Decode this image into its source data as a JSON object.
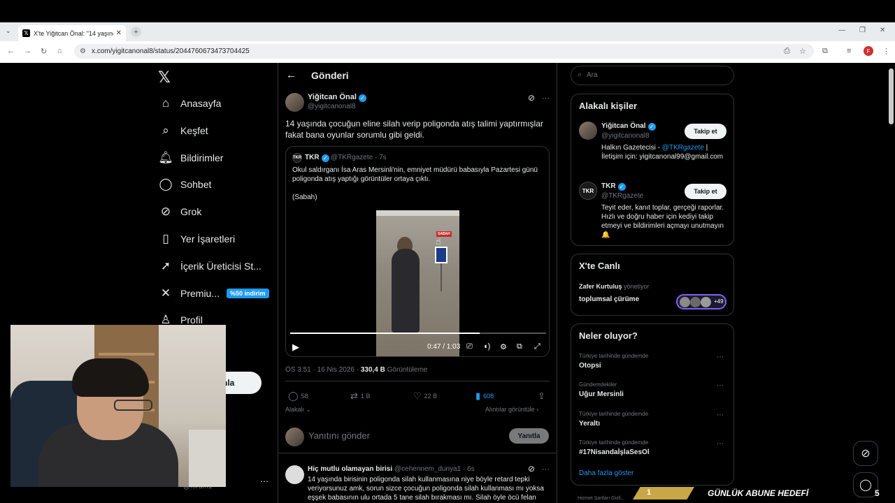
{
  "browser": {
    "tab_title": "X'te Yiğitcan Önal: \"14 yaşında",
    "url": "x.com/yigitcanonal8/status/2044760673473704425"
  },
  "nav": {
    "items": [
      {
        "label": "Anasayfa",
        "icon": "home-icon"
      },
      {
        "label": "Keşfet",
        "icon": "search-icon"
      },
      {
        "label": "Bildirimler",
        "icon": "bell-icon"
      },
      {
        "label": "Sohbet",
        "icon": "chat-icon"
      },
      {
        "label": "Grok",
        "icon": "grok-icon"
      },
      {
        "label": "Yer İşaretleri",
        "icon": "bookmark-icon"
      },
      {
        "label": "İçerik Üreticisi St...",
        "icon": "rocket-icon"
      },
      {
        "label": "Premiu...",
        "icon": "x-icon"
      },
      {
        "label": "Profil",
        "icon": "person-icon"
      }
    ],
    "premium_badge": "%50 indirim",
    "post_button": "nla",
    "account_handle": "@forum1"
  },
  "post": {
    "header_title": "Gönderi",
    "author_name": "Yiğitcan Önal",
    "author_handle": "@yigitcanonal8",
    "text": "14 yaşında çocuğun eline silah verip poligonda atış talimi yaptırmışlar fakat bana oyunlar sorumlu gibi geldi.",
    "quote": {
      "avatar": "TKR",
      "name": "TKR",
      "meta": "@TKRgazete · 7s",
      "text": "Okul saldırganı İsa Aras Mersinli'nin, emniyet müdürü babasıyla Pazartesi günü poligonda atış yaptığı görüntüler ortaya çıktı.",
      "source": "(Sabah)",
      "video_label": "SABAH",
      "video_time": "0:47 / 1:03",
      "progress": 0.74
    },
    "timestamp": "ÖS 3:51 · 16 Nis 2026 · ",
    "views": "330,4 B",
    "views_label": "Görüntüleme",
    "actions": {
      "replies": "58",
      "reposts": "1 B",
      "likes": "22 B",
      "bookmarks": "608"
    },
    "relevant_label": "Alakalı",
    "quotes_label": "Alıntılar görüntüle",
    "reply_placeholder": "Yanıtını gönder",
    "reply_button": "Yanıtla"
  },
  "reply": {
    "name": "Hiç mutlu olamayan birisi",
    "meta": "@cehennem_dunya1 · 6s",
    "text": "14 yaşında birisinin poligonda silah kullanmasına niye böyle retard tepki veriyorsunuz amk, sorun sizce çocuğun poligonda silah kullanması mı yoksa eşşek babasının ulu ortada 5 tane silah bırakması mı. Silah öyle öcü felan"
  },
  "sidebar": {
    "search_placeholder": "Ara",
    "related_title": "Alakalı kişiler",
    "people": [
      {
        "name": "Yiğitcan Önal",
        "handle": "@yigitcanonal8",
        "bio_pre": "Halkın Gazetecisi - ",
        "bio_link": "@TKRgazete",
        "bio_post": " | İletişim için: yigitcanonal99@gmail.com",
        "follow": "Takip et"
      },
      {
        "name": "TKR",
        "handle": "@TKRgazete",
        "bio": "Teyit eder, kanıt toplar, gerçeği raporlar. Hızlı ve doğru haber için kediyi takip etmeyi ve bildirimleri açmayı unutmayın 🔔",
        "follow": "Takip et"
      }
    ],
    "live_title": "X'te Canlı",
    "live_host_name": "Zafer Kurtuluş",
    "live_host_suffix": " yönetiyor",
    "live_topic": "toplumsal çürüme",
    "live_count": "+49",
    "trends_title": "Neler oluyor?",
    "trends": [
      {
        "category": "Türkiye tarihinde gündemde",
        "name": "Otopsi"
      },
      {
        "category": "Gündemdekiler",
        "name": "Uğur Mersinli"
      },
      {
        "category": "Türkiye tarihinde gündemde",
        "name": "Yeraltı"
      },
      {
        "category": "Türkiye tarihinde gündemde",
        "name": "#17NisandaİşlaSesOl"
      }
    ],
    "show_more": "Daha fazla göster",
    "footer": "Hizmet Şartları   Gizli..."
  },
  "overlay": {
    "goal_left": "1",
    "goal_text": "GÜNLÜK ABUNE HEDEFİ",
    "goal_right": "5"
  },
  "colors": {
    "accent": "#1d9bf0",
    "background": "#000000",
    "text": "#e7e9ea",
    "muted": "#71767b"
  }
}
